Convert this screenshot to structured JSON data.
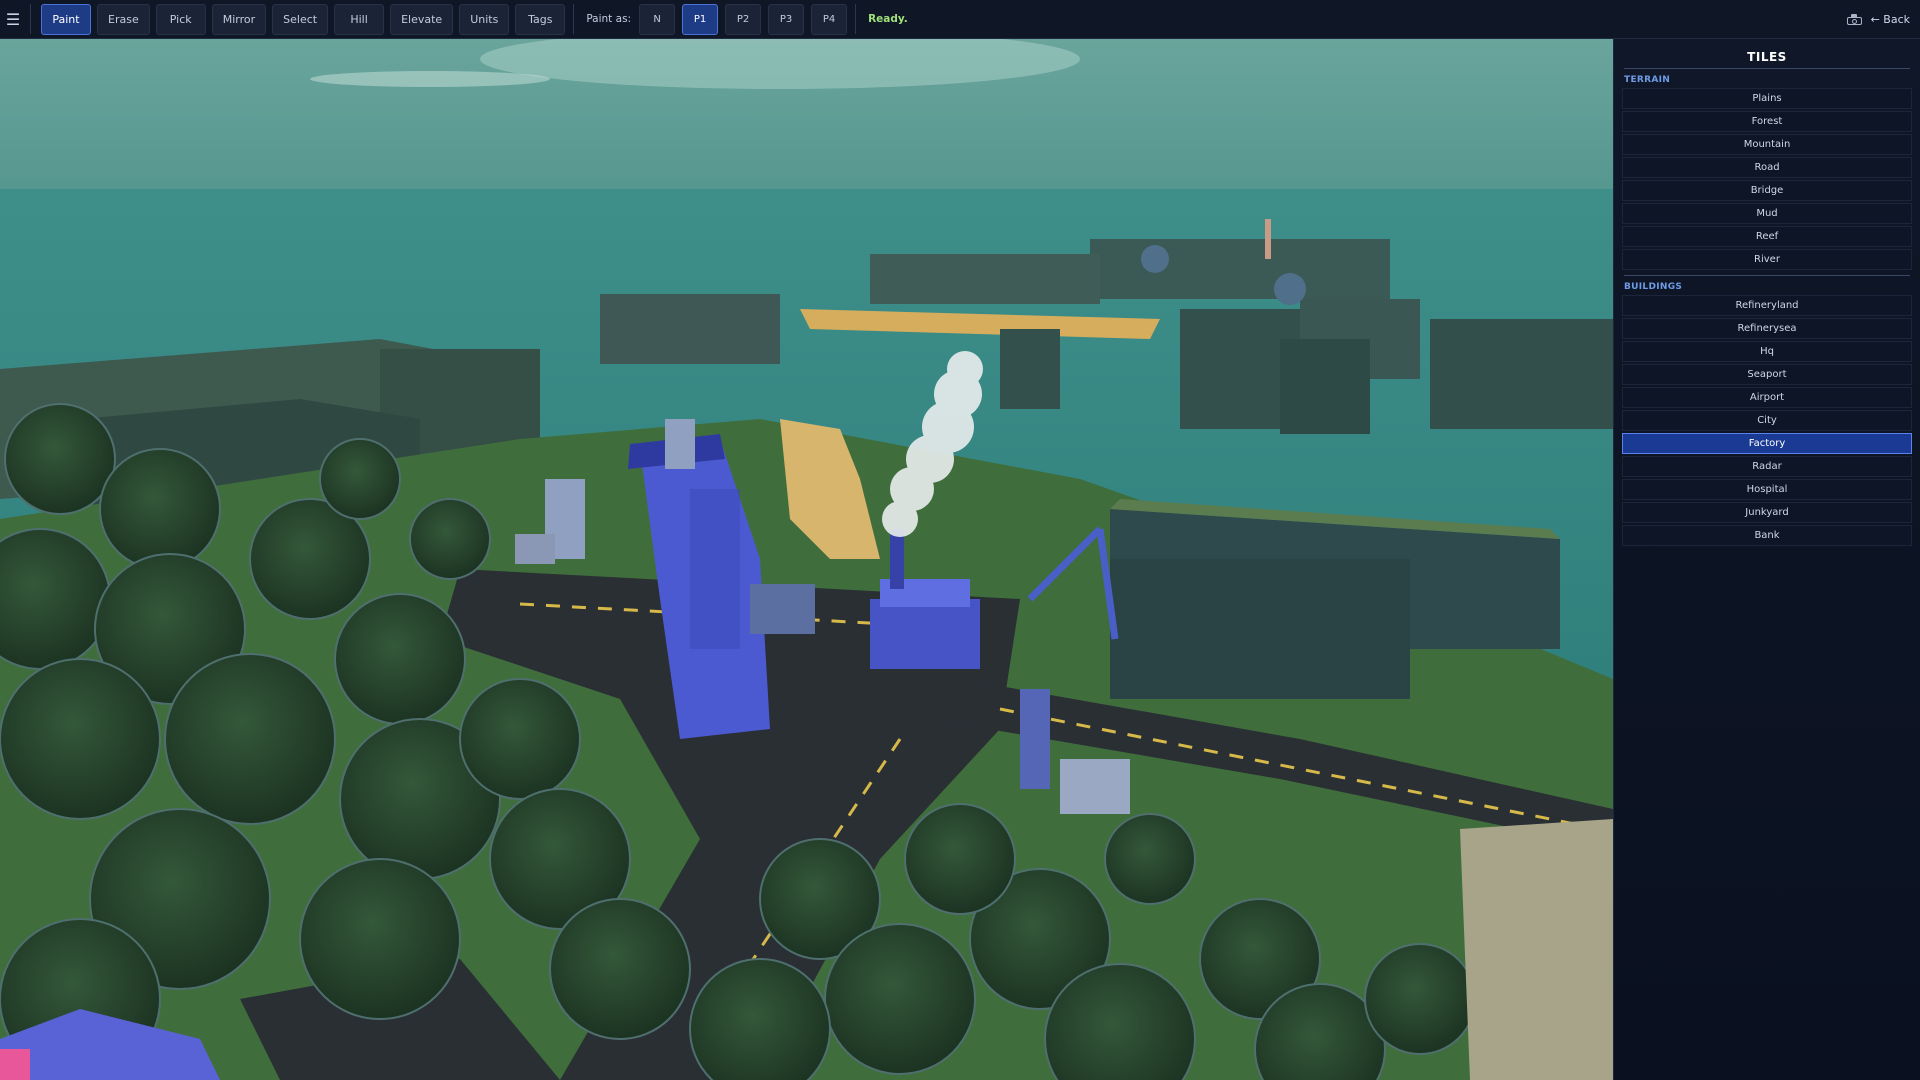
{
  "toolbar": {
    "menu_icon": "hamburger-menu-icon",
    "tools": [
      {
        "label": "Paint",
        "active": true
      },
      {
        "label": "Erase",
        "active": false
      },
      {
        "label": "Pick",
        "active": false
      },
      {
        "label": "Mirror",
        "active": false
      },
      {
        "label": "Select",
        "active": false
      },
      {
        "label": "Hill",
        "active": false
      },
      {
        "label": "Elevate",
        "active": false
      },
      {
        "label": "Units",
        "active": false
      },
      {
        "label": "Tags",
        "active": false
      }
    ],
    "paint_as_label": "Paint as:",
    "players": [
      {
        "label": "N",
        "active": false
      },
      {
        "label": "P1",
        "active": true
      },
      {
        "label": "P2",
        "active": false
      },
      {
        "label": "P3",
        "active": false
      },
      {
        "label": "P4",
        "active": false
      }
    ],
    "status": "Ready.",
    "screenshot_icon": "camera-icon",
    "back_label": "← Back"
  },
  "panel": {
    "title": "TILES",
    "terrain_label": "TERRAIN",
    "terrain": [
      "Plains",
      "Forest",
      "Mountain",
      "Road",
      "Bridge",
      "Mud",
      "Reef",
      "River"
    ],
    "buildings_label": "BUILDINGS",
    "buildings": [
      "Refineryland",
      "Refinerysea",
      "Hq",
      "Seaport",
      "Airport",
      "City",
      "Factory",
      "Radar",
      "Hospital",
      "Junkyard",
      "Bank"
    ],
    "selected": "Factory"
  },
  "colors": {
    "accent": "#1e3c86",
    "accent_border": "#4b72d8",
    "status_ok": "#9fe07a",
    "section_label": "#6f9be6",
    "sea": "#3f8a86",
    "sky": "#5c9e96",
    "forest": "#2e4e2e",
    "road": "#2a2f34",
    "player_blue": "#4656c8"
  }
}
